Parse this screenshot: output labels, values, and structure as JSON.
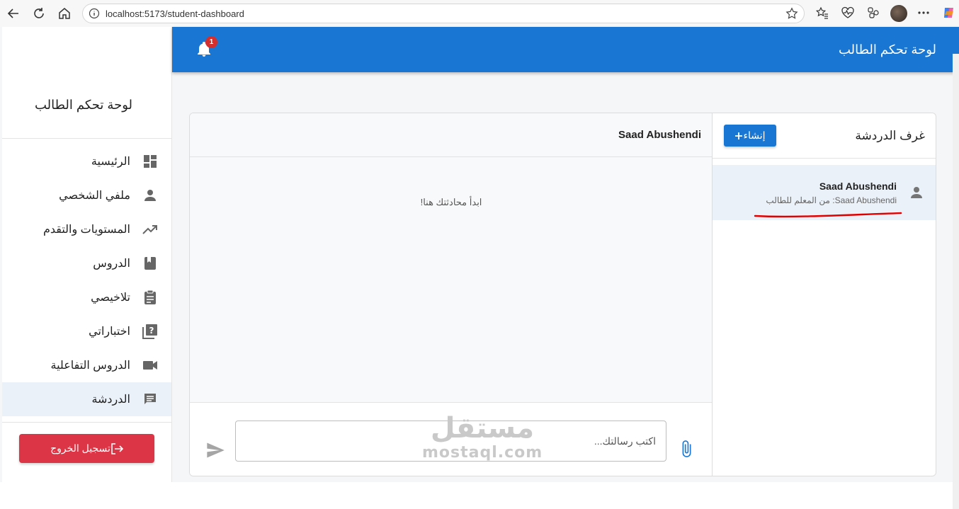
{
  "browser": {
    "url": "localhost:5173/student-dashboard",
    "icons": [
      "back-icon",
      "reload-icon",
      "home-icon",
      "info-icon",
      "star-icon",
      "favorites-icon",
      "health-icon",
      "extensions-icon",
      "profile-avatar",
      "more-icon",
      "copilot-icon"
    ]
  },
  "header": {
    "title": "لوحة تحكم الطالب",
    "notification_count": "1",
    "accent": "#1976d2"
  },
  "sidebar": {
    "title": "لوحة تحكم الطالب",
    "items": [
      {
        "label": "الرئيسية",
        "icon": "dashboard-icon"
      },
      {
        "label": "ملفي الشخصي",
        "icon": "person-icon"
      },
      {
        "label": "المستويات والتقدم",
        "icon": "trending-up-icon"
      },
      {
        "label": "الدروس",
        "icon": "book-icon"
      },
      {
        "label": "تلاخيصي",
        "icon": "clipboard-icon"
      },
      {
        "label": "اختباراتي",
        "icon": "quiz-icon"
      },
      {
        "label": "الدروس التفاعلية",
        "icon": "video-icon"
      },
      {
        "label": "الدردشة",
        "icon": "chat-icon",
        "active": true
      }
    ],
    "logout_label": "تسجيل الخروج",
    "logout_color": "#dc3545"
  },
  "rooms": {
    "title": "غرف الدردشة",
    "create_label": "إنشاء",
    "list": [
      {
        "name": "Saad Abushendi",
        "subtitle": "Saad Abushendi: من المعلم للطالب"
      }
    ]
  },
  "conversation": {
    "name": "Saad Abushendi",
    "empty_text": "ابدأ محادثتك هنا!",
    "input_placeholder": "اكتب رسالتك..."
  },
  "watermark": {
    "arabic": "مستقل",
    "latin": "mostaql.com"
  }
}
